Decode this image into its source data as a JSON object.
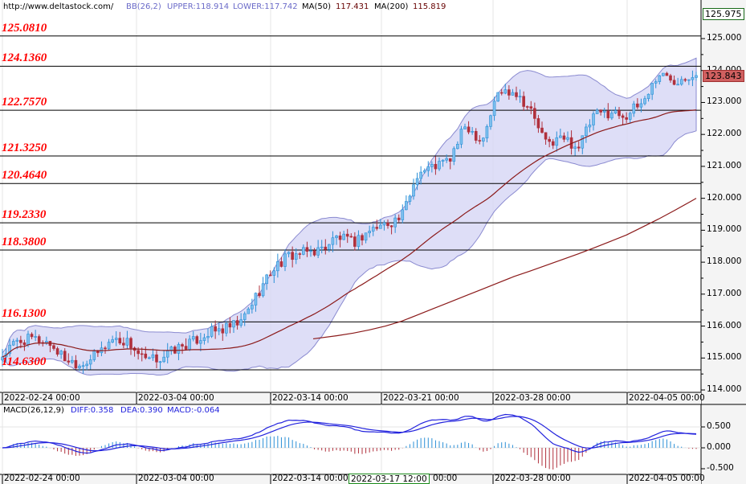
{
  "header": {
    "site": "http://www.deltastock.com/",
    "bb": "BB(26,2)",
    "upper": "UPPER:118.914",
    "lower": "LOWER:117.742",
    "ma50_label": "MA(50)",
    "ma50_value": "117.431",
    "ma200_label": "MA(200)",
    "ma200_value": "115.819"
  },
  "macd_header": {
    "label": "MACD(26,12,9)",
    "diff": "DIFF:0.358",
    "dea": "DEA:0.390",
    "macd": "MACD:-0.064"
  },
  "levels": [
    "125.0810",
    "124.1360",
    "122.7570",
    "121.3250",
    "120.4640",
    "119.2330",
    "118.3800",
    "116.1300",
    "114.6300"
  ],
  "price_axis": [
    "125.000",
    "124.000",
    "123.000",
    "122.000",
    "121.000",
    "120.000",
    "119.000",
    "118.000",
    "117.000",
    "116.000",
    "115.000",
    "114.000"
  ],
  "top_box": "125.975",
  "current_price": "123.843",
  "macd_axis": [
    "0.500",
    "0.000",
    "-0.500"
  ],
  "date_axis": [
    "2022-02-24 00:00",
    "2022-03-04 00:00",
    "2022-03-14 00:00",
    "2022-03-21 00:00",
    "2022-03-28 00:00",
    "2022-04-05 00:00"
  ],
  "bottom_axis": [
    "2022-02-24 00:00",
    "2022-03-04 00:00",
    "2022-03-14 00:00",
    "1 00:00",
    "2022-03-28 00:00",
    "2022-04-05 00:00"
  ],
  "crosshair_date": "2022-03-17 12:00",
  "colors": {
    "bull": "#2a8fd6",
    "bear": "#b0303c",
    "band": "#d6d6f5",
    "ma50": "#8b1a1a",
    "ma200": "#8b1a1a",
    "level_text": "#ff0000",
    "current_box": "#d06060"
  },
  "chart_data": {
    "type": "candlestick",
    "ylim": [
      113.9,
      126.0
    ],
    "close_path": [
      115.0,
      115.5,
      115.6,
      115.5,
      115.0,
      114.8,
      115.1,
      115.6,
      115.5,
      114.9,
      115.0,
      115.3,
      115.5,
      115.8,
      115.9,
      116.1,
      117.0,
      117.8,
      118.2,
      118.3,
      118.4,
      118.8,
      118.6,
      119.0,
      119.2,
      119.4,
      120.8,
      121.0,
      121.2,
      122.3,
      121.8,
      123.3,
      123.4,
      122.8,
      121.7,
      121.9,
      121.6,
      122.6,
      122.7,
      122.6,
      123.0,
      123.9,
      123.7,
      123.9,
      123.843
    ],
    "ma200": [
      115.6,
      115.7,
      115.78,
      115.88,
      116.0,
      116.15,
      116.35,
      116.55,
      116.75,
      116.95,
      117.15,
      117.35,
      117.55,
      117.72,
      117.9,
      118.08,
      118.26,
      118.45,
      118.65,
      118.85,
      119.1,
      119.35,
      119.62,
      119.9
    ],
    "macd_ylim": [
      -0.65,
      0.95
    ]
  }
}
